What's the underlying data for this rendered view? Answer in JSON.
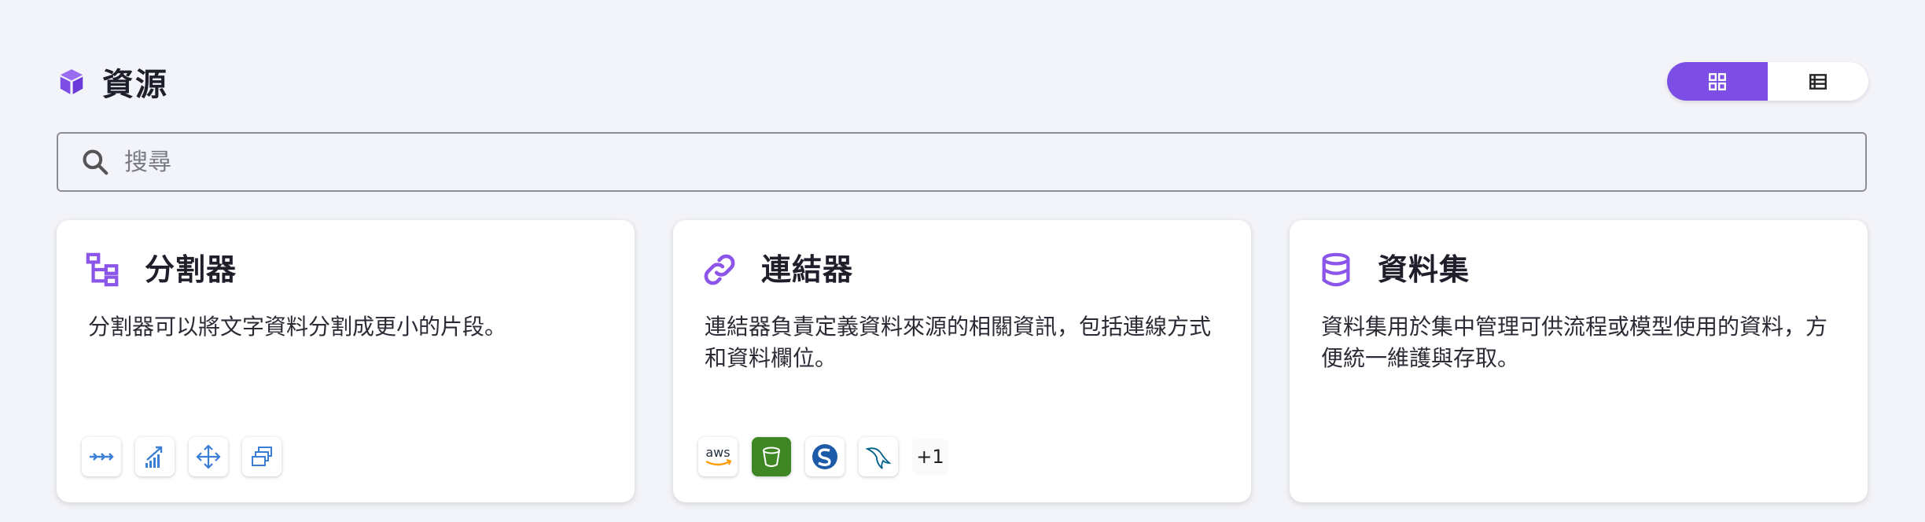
{
  "header": {
    "title": "資源"
  },
  "view_toggle": {
    "active": "grid"
  },
  "search": {
    "placeholder": "搜尋",
    "value": ""
  },
  "colors": {
    "accent": "#7d4ee6",
    "background": "#f3f4f9",
    "blue_icon": "#3a7fd5"
  },
  "cards": [
    {
      "title": "分割器",
      "description": "分割器可以將文字資料分割成更小的片段。",
      "icon": "splitter-icon",
      "logos": [
        "arrows-icon",
        "chart-arrow-icon",
        "split-cross-icon",
        "stack-icon"
      ]
    },
    {
      "title": "連結器",
      "description": "連結器負責定義資料來源的相關資訊，包括連線方式和資料欄位。",
      "icon": "link-icon",
      "logos": [
        "aws-icon",
        "bucket-icon",
        "s-logo-icon",
        "mysql-dolphin-icon"
      ],
      "logos_more": "+1",
      "aws_text": "aws"
    },
    {
      "title": "資料集",
      "description": "資料集用於集中管理可供流程或模型使用的資料，方便統一維護與存取。",
      "icon": "database-icon",
      "logos": []
    }
  ]
}
